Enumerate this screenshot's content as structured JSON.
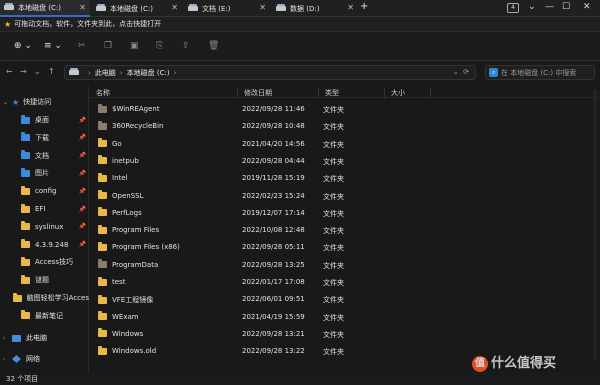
{
  "tabs": [
    {
      "label": "本地磁盘 (C:)",
      "active": true
    },
    {
      "label": "本地磁盘 (C:)",
      "active": false
    },
    {
      "label": "文档 (E:)",
      "active": false
    },
    {
      "label": "数据 (D:)",
      "active": false
    }
  ],
  "tab_count": "4",
  "tip": "可拖动文档，软件，文件夹到此，点击快捷打开",
  "breadcrumb": {
    "root": "此电脑",
    "current": "本地磁盘 (C:)"
  },
  "search": {
    "placeholder": "在 本地磁盘 (C:) 中搜索"
  },
  "sidebar": {
    "quick_access": "快捷访问",
    "items": [
      {
        "label": "桌面",
        "icon": "desktop-folder-icon",
        "pinned": true
      },
      {
        "label": "下载",
        "icon": "download-folder-icon",
        "pinned": true
      },
      {
        "label": "文档",
        "icon": "documents-folder-icon",
        "pinned": true
      },
      {
        "label": "图片",
        "icon": "pictures-folder-icon",
        "pinned": true
      },
      {
        "label": "config",
        "icon": "folder-icon",
        "pinned": true
      },
      {
        "label": "EFI",
        "icon": "folder-icon",
        "pinned": true
      },
      {
        "label": "syslinux",
        "icon": "folder-icon",
        "pinned": true
      },
      {
        "label": "4.3.9.248",
        "icon": "folder-icon",
        "pinned": true
      },
      {
        "label": "Access技巧",
        "icon": "folder-icon",
        "pinned": false
      },
      {
        "label": "谜题",
        "icon": "folder-icon",
        "pinned": false
      },
      {
        "label": "脑图轻松学习Acces",
        "icon": "folder-icon",
        "pinned": false
      },
      {
        "label": "最新笔记",
        "icon": "folder-icon",
        "pinned": false
      }
    ],
    "this_pc": "此电脑",
    "network": "网络"
  },
  "columns": {
    "name": "名称",
    "date": "修改日期",
    "type": "类型",
    "size": "大小"
  },
  "files": [
    {
      "name": "$WinREAgent",
      "date": "2022/09/28 11:46",
      "type": "文件夹",
      "dim": true
    },
    {
      "name": "360RecycleBin",
      "date": "2022/09/28 10:48",
      "type": "文件夹",
      "dim": true
    },
    {
      "name": "Go",
      "date": "2021/04/20 14:56",
      "type": "文件夹"
    },
    {
      "name": "inetpub",
      "date": "2022/09/28 04:44",
      "type": "文件夹"
    },
    {
      "name": "Intel",
      "date": "2019/11/28 15:19",
      "type": "文件夹"
    },
    {
      "name": "OpenSSL",
      "date": "2022/02/23 15:24",
      "type": "文件夹"
    },
    {
      "name": "PerfLogs",
      "date": "2019/12/07 17:14",
      "type": "文件夹"
    },
    {
      "name": "Program Files",
      "date": "2022/10/08 12:48",
      "type": "文件夹"
    },
    {
      "name": "Program Files (x86)",
      "date": "2022/09/28 05:11",
      "type": "文件夹"
    },
    {
      "name": "ProgramData",
      "date": "2022/09/28 13:25",
      "type": "文件夹",
      "dim": true
    },
    {
      "name": "test",
      "date": "2022/01/17 17:08",
      "type": "文件夹"
    },
    {
      "name": "VFE工程镜像",
      "date": "2022/06/01 09:51",
      "type": "文件夹"
    },
    {
      "name": "WExam",
      "date": "2021/04/19 15:59",
      "type": "文件夹"
    },
    {
      "name": "Windows",
      "date": "2022/09/28 13:21",
      "type": "文件夹"
    },
    {
      "name": "Windows.old",
      "date": "2022/09/28 13:22",
      "type": "文件夹"
    }
  ],
  "status": "32 个项目",
  "watermark": "什么值得买",
  "colors": {
    "accent": "#2f6bd0",
    "folder": "#e8b947",
    "background": "#191919"
  }
}
